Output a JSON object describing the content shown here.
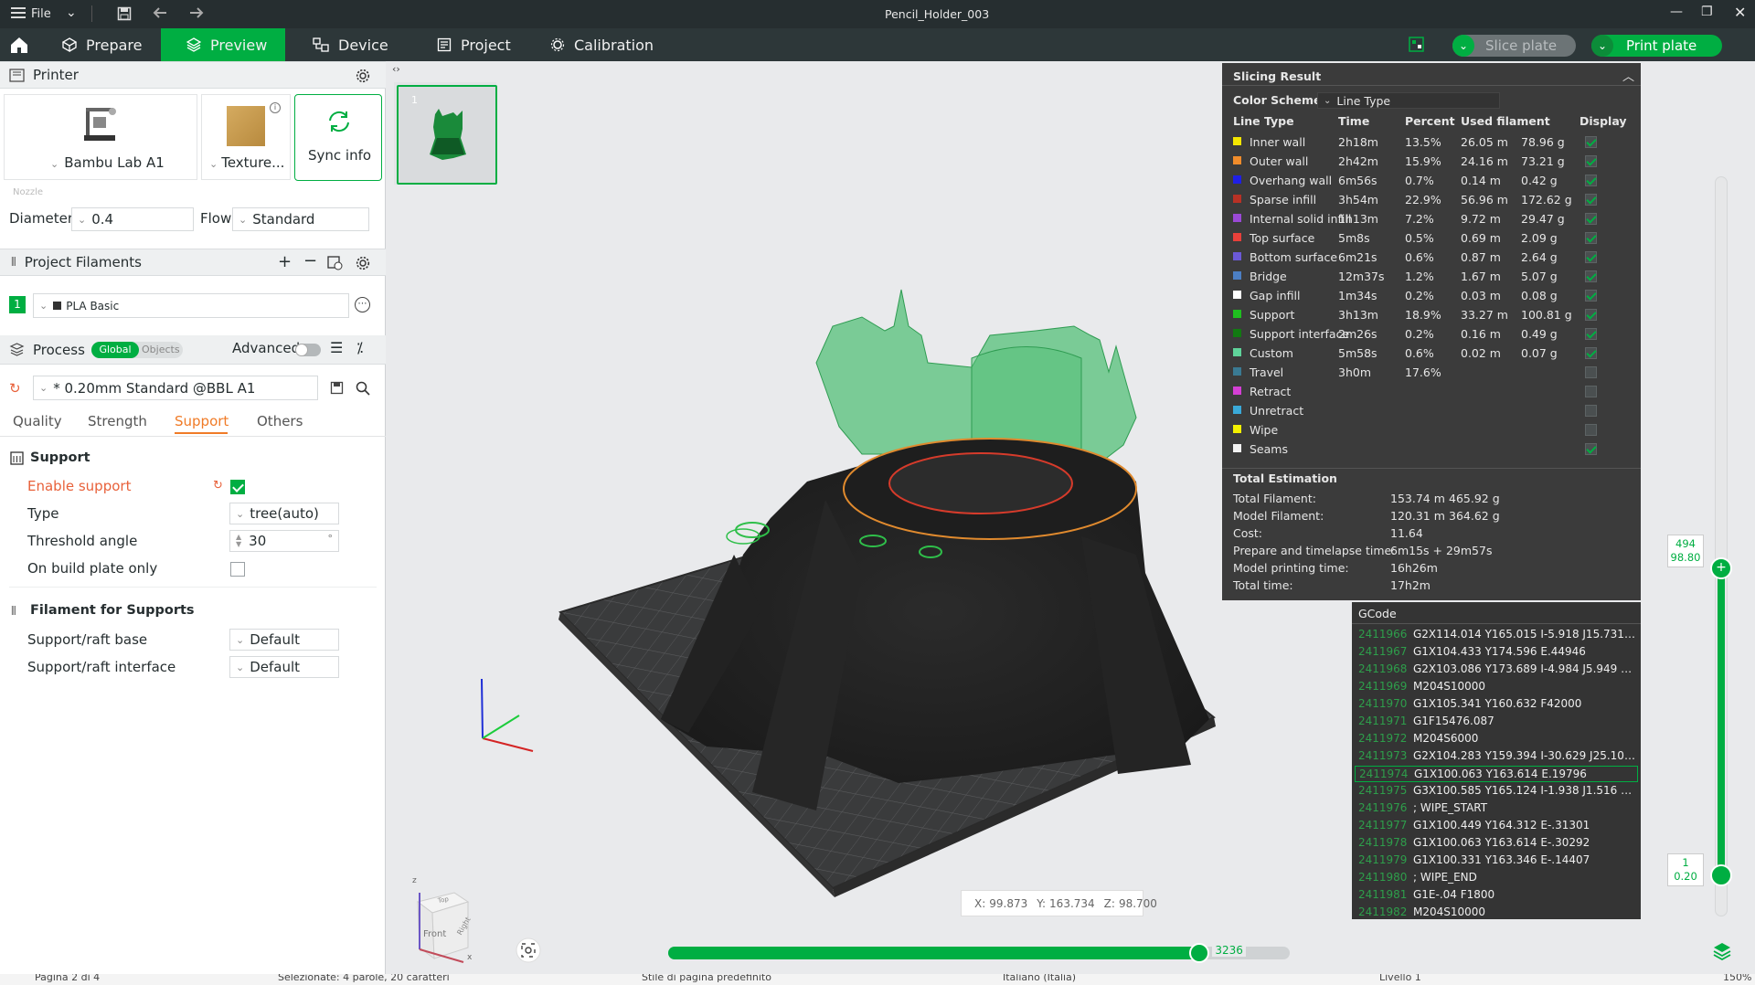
{
  "window": {
    "menu_label": "File",
    "title": "Pencil_Holder_003"
  },
  "tabs": [
    {
      "label": "Prepare"
    },
    {
      "label": "Preview"
    },
    {
      "label": "Device"
    },
    {
      "label": "Project"
    },
    {
      "label": "Calibration"
    }
  ],
  "actions": {
    "slice_label": "Slice plate",
    "print_label": "Print plate"
  },
  "printer": {
    "section_title": "Printer",
    "name": "Bambu Lab A1",
    "plate": "Texture...",
    "sync_label": "Sync info",
    "nozzle_label": "Nozzle",
    "diameter_label": "Diameter",
    "diameter_value": "0.4",
    "flow_label": "Flow",
    "flow_value": "Standard"
  },
  "filaments": {
    "section_title": "Project Filaments",
    "items": [
      {
        "index": "1",
        "name": "PLA Basic",
        "color": "#00ae42"
      }
    ]
  },
  "process": {
    "section_title": "Process",
    "toggle_global": "Global",
    "toggle_objects": "Objects",
    "advanced_label": "Advanced",
    "preset": "* 0.20mm Standard @BBL A1",
    "tabs": [
      "Quality",
      "Strength",
      "Support",
      "Others"
    ],
    "active_tab": "Support"
  },
  "support": {
    "group_title": "Support",
    "enable_label": "Enable support",
    "enable_checked": true,
    "type_label": "Type",
    "type_value": "tree(auto)",
    "threshold_label": "Threshold angle",
    "threshold_value": "30",
    "threshold_unit": "°",
    "build_plate_label": "On build plate only",
    "build_plate_checked": false,
    "filament_group_title": "Filament for Supports",
    "base_label": "Support/raft base",
    "base_value": "Default",
    "interface_label": "Support/raft interface",
    "interface_value": "Default"
  },
  "slicing": {
    "title": "Slicing Result",
    "color_scheme_label": "Color Scheme",
    "color_scheme_value": "Line Type",
    "headers": [
      "Line Type",
      "Time",
      "Percent",
      "Used filament",
      "Display"
    ],
    "rows": [
      {
        "name": "Inner wall",
        "color": "#f3e600",
        "time": "2h18m",
        "percent": "13.5%",
        "len": "26.05 m",
        "weight": "78.96 g",
        "display": true
      },
      {
        "name": "Outer wall",
        "color": "#f08c2b",
        "time": "2h42m",
        "percent": "15.9%",
        "len": "24.16 m",
        "weight": "73.21 g",
        "display": true
      },
      {
        "name": "Overhang wall",
        "color": "#1f1fe6",
        "time": "6m56s",
        "percent": "0.7%",
        "len": "0.14 m",
        "weight": "0.42 g",
        "display": true
      },
      {
        "name": "Sparse infill",
        "color": "#b83125",
        "time": "3h54m",
        "percent": "22.9%",
        "len": "56.96 m",
        "weight": "172.62 g",
        "display": true
      },
      {
        "name": "Internal solid infill",
        "color": "#9a49d6",
        "time": "1h13m",
        "percent": "7.2%",
        "len": "9.72 m",
        "weight": "29.47 g",
        "display": true
      },
      {
        "name": "Top surface",
        "color": "#e8403a",
        "time": "5m8s",
        "percent": "0.5%",
        "len": "0.69 m",
        "weight": "2.09 g",
        "display": true
      },
      {
        "name": "Bottom surface",
        "color": "#6b59d8",
        "time": "6m21s",
        "percent": "0.6%",
        "len": "0.87 m",
        "weight": "2.64 g",
        "display": true
      },
      {
        "name": "Bridge",
        "color": "#4c7fc4",
        "time": "12m37s",
        "percent": "1.2%",
        "len": "1.67 m",
        "weight": "5.07 g",
        "display": true
      },
      {
        "name": "Gap infill",
        "color": "#ffffff",
        "time": "1m34s",
        "percent": "0.2%",
        "len": "0.03 m",
        "weight": "0.08 g",
        "display": true
      },
      {
        "name": "Support",
        "color": "#1fbf1f",
        "time": "3h13m",
        "percent": "18.9%",
        "len": "33.27 m",
        "weight": "100.81 g",
        "display": true
      },
      {
        "name": "Support interface",
        "color": "#127a12",
        "time": "2m26s",
        "percent": "0.2%",
        "len": "0.16 m",
        "weight": "0.49 g",
        "display": true
      },
      {
        "name": "Custom",
        "color": "#5fd39a",
        "time": "5m58s",
        "percent": "0.6%",
        "len": "0.02 m",
        "weight": "0.07 g",
        "display": true
      },
      {
        "name": "Travel",
        "color": "#3a7a93",
        "time": "3h0m",
        "percent": "17.6%",
        "len": "",
        "weight": "",
        "display": false
      },
      {
        "name": "Retract",
        "color": "#d43fd4",
        "time": "",
        "percent": "",
        "len": "",
        "weight": "",
        "display": false
      },
      {
        "name": "Unretract",
        "color": "#3aa9d8",
        "time": "",
        "percent": "",
        "len": "",
        "weight": "",
        "display": false
      },
      {
        "name": "Wipe",
        "color": "#f3f000",
        "time": "",
        "percent": "",
        "len": "",
        "weight": "",
        "display": false
      },
      {
        "name": "Seams",
        "color": "#f2f2f2",
        "time": "",
        "percent": "",
        "len": "",
        "weight": "",
        "display": true
      }
    ],
    "total_title": "Total Estimation",
    "totals": [
      {
        "label": "Total Filament:",
        "v1": "153.74 m",
        "v2": "465.92 g"
      },
      {
        "label": "Model Filament:",
        "v1": "120.31 m",
        "v2": "364.62 g"
      },
      {
        "label": "Cost:",
        "v1": "11.64",
        "v2": ""
      },
      {
        "label": "Prepare and timelapse time:",
        "v1": "6m15s + 29m57s",
        "v2": ""
      },
      {
        "label": "Model printing time:",
        "v1": "16h26m",
        "v2": ""
      },
      {
        "label": "Total time:",
        "v1": "17h2m",
        "v2": ""
      }
    ]
  },
  "gcode": {
    "title": "GCode",
    "lines": [
      {
        "n": "2411966",
        "c": "G2X114.014 Y165.015 I-5.918 J15.731 ..."
      },
      {
        "n": "2411967",
        "c": "G1X104.433 Y174.596 E.44946"
      },
      {
        "n": "2411968",
        "c": "G2X103.086 Y173.689 I-4.984 J5.949 E..."
      },
      {
        "n": "2411969",
        "c": "M204S10000"
      },
      {
        "n": "2411970",
        "c": "G1X105.341 Y160.632 F42000"
      },
      {
        "n": "2411971",
        "c": "G1F15476.087"
      },
      {
        "n": "2411972",
        "c": "M204S6000"
      },
      {
        "n": "2411973",
        "c": "G2X104.283 Y159.394 I-30.629 J25.105..."
      },
      {
        "n": "2411974",
        "c": "G1X100.063 Y163.614 E.19796"
      },
      {
        "n": "2411975",
        "c": "G3X100.585 Y165.124 I-1.938 J1.516 E..."
      },
      {
        "n": "2411976",
        "c": "; WIPE_START"
      },
      {
        "n": "2411977",
        "c": "G1X100.449 Y164.312 E-.31301"
      },
      {
        "n": "2411978",
        "c": "G1X100.063 Y163.614 E-.30292"
      },
      {
        "n": "2411979",
        "c": "G1X100.331 Y163.346 E-.14407"
      },
      {
        "n": "2411980",
        "c": "; WIPE_END"
      },
      {
        "n": "2411981",
        "c": "G1E-.04 F1800"
      },
      {
        "n": "2411982",
        "c": "M204S10000"
      }
    ],
    "highlight_index": 8
  },
  "layer_slider": {
    "top_layer": "494",
    "top_height": "98.80",
    "bottom_layer": "1",
    "bottom_height": "0.20"
  },
  "move_slider": {
    "value": "3236",
    "fraction": 0.855
  },
  "coords": {
    "x_label": "X:",
    "x": "99.873",
    "y_label": "Y:",
    "y": "163.734",
    "z_label": "Z:",
    "z": "98.700"
  },
  "plate_thumb": {
    "index": "1"
  },
  "view_cube": {
    "front": "Front",
    "right": "Right",
    "top": "Top",
    "x": "x",
    "z": "z"
  },
  "statusbar": {
    "page": "Pagina 2 di 4",
    "selection": "Selezionate: 4 parole, 20 caratteri",
    "style": "Stile di pagina predefinito",
    "language": "Italiano (Italia)",
    "level": "Livello 1",
    "zoom": "150%"
  }
}
